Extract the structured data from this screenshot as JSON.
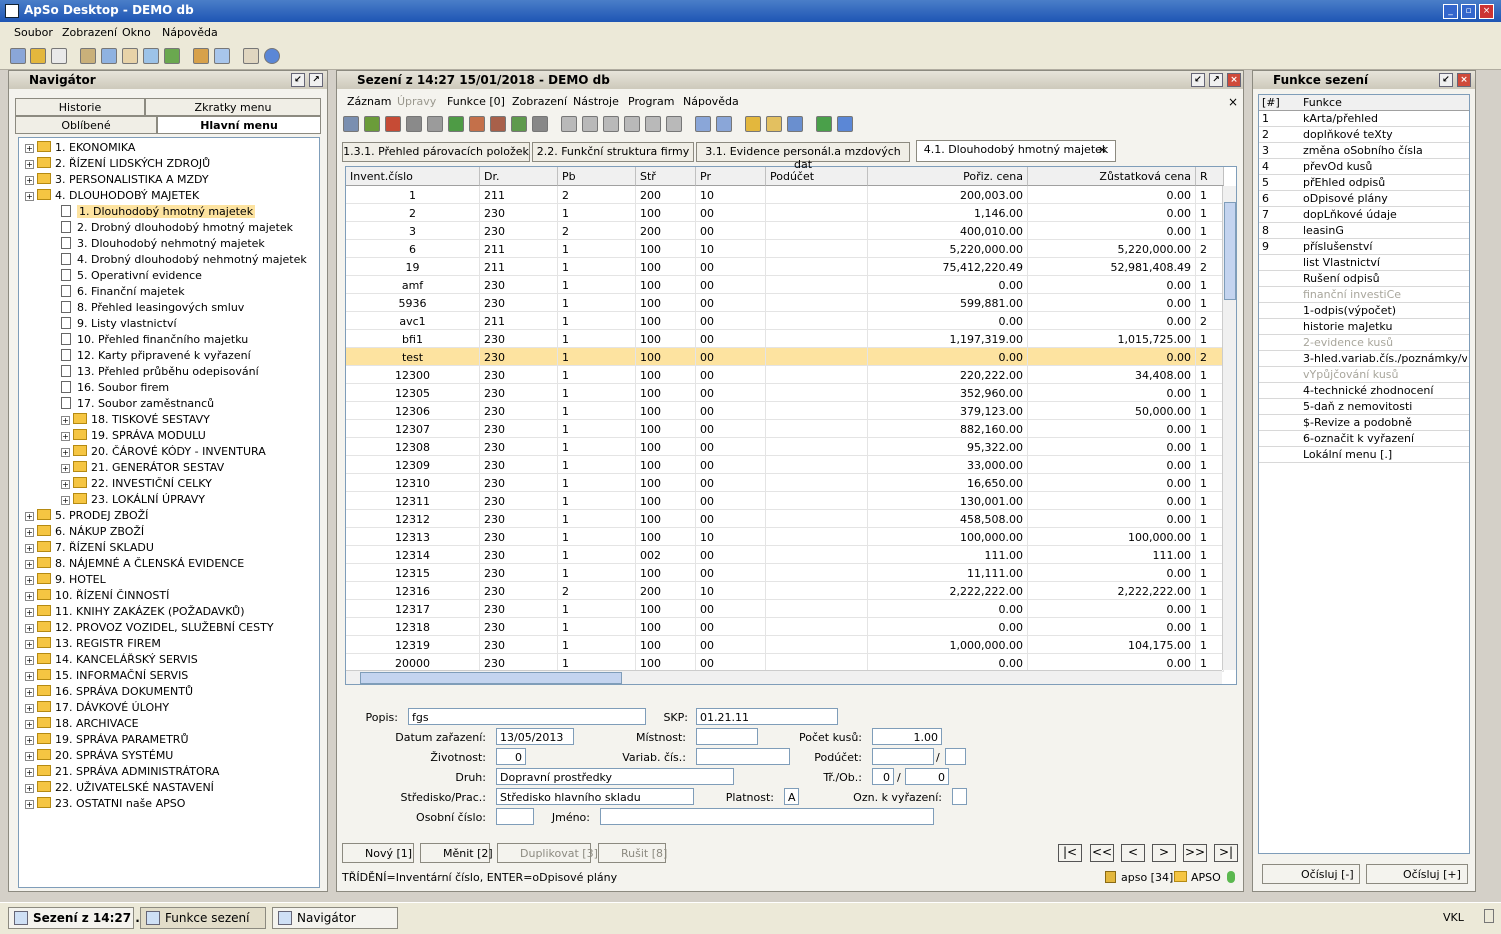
{
  "app": {
    "title": "ApSo Desktop - DEMO db"
  },
  "menu": [
    "Soubor",
    "Zobrazení",
    "Okno",
    "Nápověda"
  ],
  "navigator": {
    "title": "Navigátor",
    "tabs": {
      "historie": "Historie",
      "zkratky": "Zkratky menu",
      "oblibene": "Oblíbené",
      "hlavni": "Hlavní menu"
    },
    "tree": [
      {
        "t": "1. EKONOMIKA",
        "lvl": 0,
        "k": "f"
      },
      {
        "t": "2. ŘÍZENÍ LIDSKÝCH ZDROJŮ",
        "lvl": 0,
        "k": "f"
      },
      {
        "t": "3. PERSONALISTIKA A MZDY",
        "lvl": 0,
        "k": "f"
      },
      {
        "t": "4. DLOUHODOBÝ MAJETEK",
        "lvl": 0,
        "k": "f"
      },
      {
        "t": "1. Dlouhodobý hmotný majetek",
        "lvl": 1,
        "k": "d",
        "sel": true
      },
      {
        "t": "2. Drobný dlouhodobý hmotný majetek",
        "lvl": 1,
        "k": "d"
      },
      {
        "t": "3. Dlouhodobý nehmotný majetek",
        "lvl": 1,
        "k": "d"
      },
      {
        "t": "4. Drobný dlouhodobý nehmotný majetek",
        "lvl": 1,
        "k": "d"
      },
      {
        "t": "5. Operativní evidence",
        "lvl": 1,
        "k": "d"
      },
      {
        "t": "6. Finanční majetek",
        "lvl": 1,
        "k": "d"
      },
      {
        "t": "8. Přehled leasingových smluv",
        "lvl": 1,
        "k": "d"
      },
      {
        "t": "9. Listy vlastnictví",
        "lvl": 1,
        "k": "d"
      },
      {
        "t": "10. Přehled finančního majetku",
        "lvl": 1,
        "k": "d"
      },
      {
        "t": "12. Karty připravené k vyřazení",
        "lvl": 1,
        "k": "d"
      },
      {
        "t": "13. Přehled průběhu odepisování",
        "lvl": 1,
        "k": "d"
      },
      {
        "t": "16. Soubor firem",
        "lvl": 1,
        "k": "d"
      },
      {
        "t": "17. Soubor zaměstnanců",
        "lvl": 1,
        "k": "d"
      },
      {
        "t": "18. TISKOVÉ SESTAVY",
        "lvl": 1,
        "k": "f"
      },
      {
        "t": "19. SPRÁVA MODULU",
        "lvl": 1,
        "k": "f"
      },
      {
        "t": "20. ČÁROVÉ KÓDY - INVENTURA",
        "lvl": 1,
        "k": "f"
      },
      {
        "t": "21. GENERÁTOR SESTAV",
        "lvl": 1,
        "k": "f"
      },
      {
        "t": "22. INVESTIČNÍ CELKY",
        "lvl": 1,
        "k": "f"
      },
      {
        "t": "23. LOKÁLNÍ ÚPRAVY",
        "lvl": 1,
        "k": "f"
      },
      {
        "t": "5. PRODEJ ZBOŽÍ",
        "lvl": 0,
        "k": "f"
      },
      {
        "t": "6. NÁKUP ZBOŽÍ",
        "lvl": 0,
        "k": "f"
      },
      {
        "t": "7. ŘÍZENÍ SKLADU",
        "lvl": 0,
        "k": "f"
      },
      {
        "t": "8. NÁJEMNÉ A ČLENSKÁ EVIDENCE",
        "lvl": 0,
        "k": "f"
      },
      {
        "t": "9. HOTEL",
        "lvl": 0,
        "k": "f"
      },
      {
        "t": "10. ŘÍZENÍ ČINNOSTÍ",
        "lvl": 0,
        "k": "f"
      },
      {
        "t": "11. KNIHY ZAKÁZEK (POŽADAVKŮ)",
        "lvl": 0,
        "k": "f"
      },
      {
        "t": "12. PROVOZ VOZIDEL, SLUŽEBNÍ CESTY",
        "lvl": 0,
        "k": "f"
      },
      {
        "t": "13. REGISTR FIREM",
        "lvl": 0,
        "k": "f"
      },
      {
        "t": "14. KANCELÁŘSKÝ SERVIS",
        "lvl": 0,
        "k": "f"
      },
      {
        "t": "15. INFORMAČNÍ SERVIS",
        "lvl": 0,
        "k": "f"
      },
      {
        "t": "16. SPRÁVA DOKUMENTŮ",
        "lvl": 0,
        "k": "f"
      },
      {
        "t": "17. DÁVKOVÉ ÚLOHY",
        "lvl": 0,
        "k": "f"
      },
      {
        "t": "18. ARCHIVACE",
        "lvl": 0,
        "k": "f"
      },
      {
        "t": "19. SPRÁVA PARAMETRŮ",
        "lvl": 0,
        "k": "f"
      },
      {
        "t": "20. SPRÁVA SYSTÉMU",
        "lvl": 0,
        "k": "f"
      },
      {
        "t": "21. SPRÁVA ADMINISTRÁTORA",
        "lvl": 0,
        "k": "f"
      },
      {
        "t": "22. UŽIVATELSKÉ NASTAVENÍ",
        "lvl": 0,
        "k": "f"
      },
      {
        "t": "23. OSTATNI naše APSO",
        "lvl": 0,
        "k": "f"
      }
    ]
  },
  "session": {
    "title": "Sezení z 14:27 15/01/2018 - DEMO db",
    "menu": [
      {
        "l": "Záznam",
        "d": false
      },
      {
        "l": "Úpravy",
        "d": true
      },
      {
        "l": "Funkce [0]",
        "d": false
      },
      {
        "l": "Zobrazení",
        "d": false
      },
      {
        "l": "Nástroje",
        "d": false
      },
      {
        "l": "Program",
        "d": false
      },
      {
        "l": "Nápověda",
        "d": false
      }
    ],
    "tabs": [
      "1.3.1. Přehled párovacích položek",
      "2.2. Funkční struktura firmy",
      "3.1. Evidence personál.a mzdových dat",
      "4.1. Dlouhodobý hmotný majetek"
    ],
    "tab_close": "×",
    "columns": [
      "Invent.číslo",
      "Dr.",
      "Pb",
      "Stř",
      "Pr",
      "Podúčet",
      "Pořiz. cena",
      "Zůstatková cena",
      "R"
    ],
    "rows": [
      [
        "1",
        "211",
        "2",
        "200",
        "10",
        "",
        "200,003.00",
        "0.00",
        "1"
      ],
      [
        "2",
        "230",
        "1",
        "100",
        "00",
        "",
        "1,146.00",
        "0.00",
        "1"
      ],
      [
        "3",
        "230",
        "2",
        "200",
        "00",
        "",
        "400,010.00",
        "0.00",
        "1"
      ],
      [
        "6",
        "211",
        "1",
        "100",
        "10",
        "",
        "5,220,000.00",
        "5,220,000.00",
        "2"
      ],
      [
        "19",
        "211",
        "1",
        "100",
        "00",
        "",
        "75,412,220.49",
        "52,981,408.49",
        "2"
      ],
      [
        "amf",
        "230",
        "1",
        "100",
        "00",
        "",
        "0.00",
        "0.00",
        "1"
      ],
      [
        "5936",
        "230",
        "1",
        "100",
        "00",
        "",
        "599,881.00",
        "0.00",
        "1"
      ],
      [
        "avc1",
        "211",
        "1",
        "100",
        "00",
        "",
        "0.00",
        "0.00",
        "2"
      ],
      [
        "bfi1",
        "230",
        "1",
        "100",
        "00",
        "",
        "1,197,319.00",
        "1,015,725.00",
        "1"
      ],
      [
        "test",
        "230",
        "1",
        "100",
        "00",
        "",
        "0.00",
        "0.00",
        "2"
      ],
      [
        "12300",
        "230",
        "1",
        "100",
        "00",
        "",
        "220,222.00",
        "34,408.00",
        "1"
      ],
      [
        "12305",
        "230",
        "1",
        "100",
        "00",
        "",
        "352,960.00",
        "0.00",
        "1"
      ],
      [
        "12306",
        "230",
        "1",
        "100",
        "00",
        "",
        "379,123.00",
        "50,000.00",
        "1"
      ],
      [
        "12307",
        "230",
        "1",
        "100",
        "00",
        "",
        "882,160.00",
        "0.00",
        "1"
      ],
      [
        "12308",
        "230",
        "1",
        "100",
        "00",
        "",
        "95,322.00",
        "0.00",
        "1"
      ],
      [
        "12309",
        "230",
        "1",
        "100",
        "00",
        "",
        "33,000.00",
        "0.00",
        "1"
      ],
      [
        "12310",
        "230",
        "1",
        "100",
        "00",
        "",
        "16,650.00",
        "0.00",
        "1"
      ],
      [
        "12311",
        "230",
        "1",
        "100",
        "00",
        "",
        "130,001.00",
        "0.00",
        "1"
      ],
      [
        "12312",
        "230",
        "1",
        "100",
        "00",
        "",
        "458,508.00",
        "0.00",
        "1"
      ],
      [
        "12313",
        "230",
        "1",
        "100",
        "10",
        "",
        "100,000.00",
        "100,000.00",
        "1"
      ],
      [
        "12314",
        "230",
        "1",
        "002",
        "00",
        "",
        "111.00",
        "111.00",
        "1"
      ],
      [
        "12315",
        "230",
        "1",
        "100",
        "00",
        "",
        "11,111.00",
        "0.00",
        "1"
      ],
      [
        "12316",
        "230",
        "2",
        "200",
        "10",
        "",
        "2,222,222.00",
        "2,222,222.00",
        "1"
      ],
      [
        "12317",
        "230",
        "1",
        "100",
        "00",
        "",
        "0.00",
        "0.00",
        "1"
      ],
      [
        "12318",
        "230",
        "1",
        "100",
        "00",
        "",
        "0.00",
        "0.00",
        "1"
      ],
      [
        "12319",
        "230",
        "1",
        "100",
        "00",
        "",
        "1,000,000.00",
        "104,175.00",
        "1"
      ],
      [
        "20000",
        "230",
        "1",
        "100",
        "00",
        "",
        "0.00",
        "0.00",
        "1"
      ]
    ],
    "selected_row": 9,
    "form": {
      "popis_l": "Popis:",
      "popis": "fgs",
      "skp_l": "SKP:",
      "skp": "01.21.11",
      "datum_l": "Datum zařazení:",
      "datum": "13/05/2013",
      "mistnost_l": "Místnost:",
      "mistnost": "",
      "pocet_l": "Počet kusů:",
      "pocet": "1.00",
      "zivot_l": "Životnost:",
      "zivot": "0",
      "variab_l": "Variab. čís.:",
      "variab": "",
      "podu_l": "Podúčet:",
      "podu": "",
      "podu_sep": "/",
      "podu2": "",
      "druh_l": "Druh:",
      "druh": "Dopravní prostředky",
      "trob_l": "Tř./Ob.:",
      "tr": "0",
      "trob_sep": "/",
      "ob": "0",
      "stred_l": "Středisko/Prac.:",
      "stred": "Středisko hlavního skladu",
      "plat_l": "Platnost:",
      "plat": "A",
      "ozn_l": "Ozn. k vyřazení:",
      "ozn": "",
      "osob_l": "Osobní číslo:",
      "osob": "",
      "jmeno_l": "Jméno:",
      "jmeno": ""
    },
    "buttons": {
      "novy": "Nový [1]",
      "menit": "Měnit [2]",
      "dupl": "Duplikovat [3]",
      "rusit": "Rušit [8]"
    },
    "nav": {
      "first": "|<",
      "prevpage": "<<",
      "prev": "<",
      "next": ">",
      "nextpage": ">>",
      "last": ">|"
    },
    "status": {
      "left": "TŘÍDĚNÍ=Inventární číslo, ENTER=oDpisové plány",
      "user": "apso [34]",
      "db": "APSO"
    }
  },
  "functions": {
    "title": "Funkce sezení",
    "col_num": "[#]",
    "col_name": "Funkce",
    "items": [
      {
        "n": "1",
        "f": "kArta/přehled",
        "d": false
      },
      {
        "n": "2",
        "f": "doplňkové teXty",
        "d": false
      },
      {
        "n": "3",
        "f": "změna oSobního čísla",
        "d": false
      },
      {
        "n": "4",
        "f": "převOd kusů",
        "d": false
      },
      {
        "n": "5",
        "f": "přEhled odpisů",
        "d": false
      },
      {
        "n": "6",
        "f": "oDpisové plány",
        "d": false
      },
      {
        "n": "7",
        "f": "dopLňkové údaje",
        "d": false
      },
      {
        "n": "8",
        "f": "leasinG",
        "d": false
      },
      {
        "n": "9",
        "f": "příslušenství",
        "d": false
      },
      {
        "n": "",
        "f": "list Vlastnictví",
        "d": false
      },
      {
        "n": "",
        "f": "Rušení odpisů",
        "d": false
      },
      {
        "n": "",
        "f": "finanční investiCe",
        "d": true
      },
      {
        "n": "",
        "f": "1-odpis(výpočet)",
        "d": false
      },
      {
        "n": "",
        "f": "historie maJetku",
        "d": false
      },
      {
        "n": "",
        "f": "2-evidence kusů",
        "d": true
      },
      {
        "n": "",
        "f": "3-hled.variab.čís./poznámky/v...",
        "d": false
      },
      {
        "n": "",
        "f": "vYpůjčování kusů",
        "d": true
      },
      {
        "n": "",
        "f": "4-technické zhodnocení",
        "d": false
      },
      {
        "n": "",
        "f": "5-daň z nemovitosti",
        "d": false
      },
      {
        "n": "",
        "f": "$-Revize a podobně",
        "d": false
      },
      {
        "n": "",
        "f": "6-označit k vyřazení",
        "d": false
      },
      {
        "n": "",
        "f": "Lokální menu [.]",
        "d": false
      }
    ],
    "ocisluj_minus": "Očísluj [-]",
    "ocisluj_plus": "Očísluj [+]"
  },
  "taskbar": {
    "items": [
      "Sezení z 14:27 ...",
      "Funkce sezení",
      "Navigátor"
    ],
    "status": "VKL"
  },
  "colors": {
    "selected_row": "#fde3a0",
    "title_blue": "#1e55b4",
    "tree_selected": "#fde3a0"
  }
}
